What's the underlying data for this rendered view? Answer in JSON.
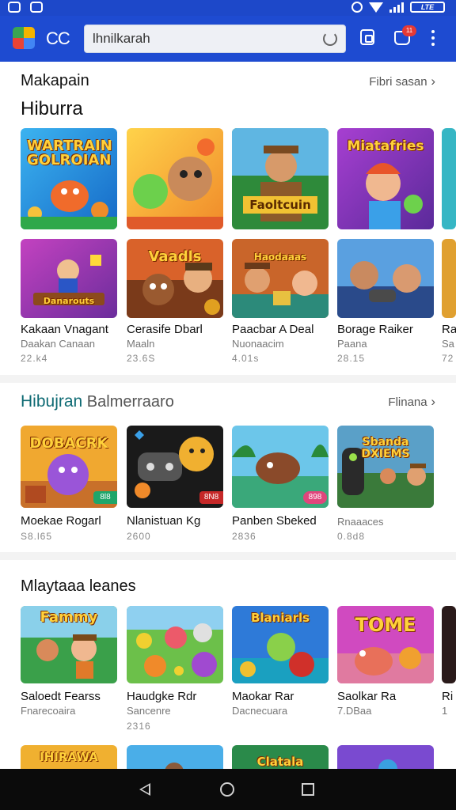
{
  "status_bar": {
    "battery": "LTE"
  },
  "app_bar": {
    "brand": "CC",
    "search": {
      "value": "lhnilkarah"
    },
    "cart_badge": "11",
    "icons": [
      "logo-icon",
      "refresh-icon",
      "cast-icon",
      "cart-icon",
      "more-icon"
    ]
  },
  "sections": {
    "s1": {
      "overline": "Makapain",
      "title": "Hiburra",
      "link": "Fibri sasan",
      "top_tiles": [
        {
          "banner": "WARTRAIN GOLROIAN",
          "theme": "blue-yellow"
        },
        {
          "banner": "",
          "theme": "orange-toys"
        },
        {
          "banner": "Faoltcuin",
          "theme": "green-cowboy"
        },
        {
          "banner": "Miatafries",
          "theme": "purple-boy"
        },
        {
          "banner": "",
          "theme": "teal-partial"
        }
      ],
      "items": [
        {
          "name": "Kakaan Vnagant",
          "sub": "Daakan Canaan",
          "price": "22.k4",
          "banner": "Danarouts",
          "theme": "purple-adventure"
        },
        {
          "name": "Cerasife Dbarl",
          "sub": "Maaln",
          "price": "23.6S",
          "banner": "Vaadls",
          "theme": "brown-bear"
        },
        {
          "name": "Paacbar A Deal",
          "sub": "Nuonaacim",
          "price": "4.01s",
          "banner": "Haodaaas",
          "theme": "orange-party"
        },
        {
          "name": "Borage Raiker",
          "sub": "Paana",
          "price": "28.15",
          "banner": "",
          "theme": "gamers"
        },
        {
          "name": "Ra",
          "sub": "Sa",
          "price": "72",
          "banner": "",
          "theme": "partial"
        }
      ]
    },
    "s2": {
      "title_accent": "Hibujran",
      "title_rest": "Balmerraaro",
      "link": "Flinana",
      "items": [
        {
          "name": "Moekae Rogarl",
          "sub": "S8.l65",
          "badge": "8l8",
          "banner": "DOBACRK",
          "theme": "purple-monster"
        },
        {
          "name": "Nlanistuan Kg",
          "sub": "2600",
          "badge": "8N8",
          "banner": "",
          "theme": "dark-controller"
        },
        {
          "name": "Panben Sbeked",
          "sub": "2836",
          "badge": "898",
          "banner": "",
          "theme": "beach-beast"
        },
        {
          "name": "Rnaaaces",
          "sub": "0.8d8",
          "badge": "",
          "banner": "Sbanda DXIEMS",
          "theme": "jungle-cast"
        }
      ]
    },
    "s3": {
      "title": "Mlaytaaa leanes",
      "items": [
        {
          "name": "Saloedt Fearss",
          "sub": "Fnarecoaira",
          "price": "",
          "banner": "Fammy",
          "theme": "jungle-kids"
        },
        {
          "name": "Haudgke Rdr",
          "sub": "Sancenre",
          "price": "2316",
          "banner": "",
          "theme": "green-monsters"
        },
        {
          "name": "Maokar Rar",
          "sub": "Dacnecuara",
          "price": "",
          "banner": "Blaniarls",
          "theme": "blue-fish"
        },
        {
          "name": "Saolkar Ra",
          "sub": "7.DBaa",
          "price": "",
          "banner": "TOME",
          "theme": "pink-dragon"
        },
        {
          "name": "Ri",
          "sub": "1",
          "price": "",
          "banner": "",
          "theme": "partial-dark"
        }
      ],
      "bottom_tiles": [
        {
          "banner": "IHIRAWA",
          "theme": "yellow"
        },
        {
          "banner": "",
          "theme": "sky"
        },
        {
          "banner": "Clatala",
          "theme": "jungle"
        },
        {
          "banner": "",
          "theme": "violet"
        }
      ]
    }
  },
  "colors": {
    "primary": "#1e4bd1",
    "accent_title": "#0f6b74",
    "tag_green": "#1fa66a",
    "tag_pink": "#e0457c"
  }
}
